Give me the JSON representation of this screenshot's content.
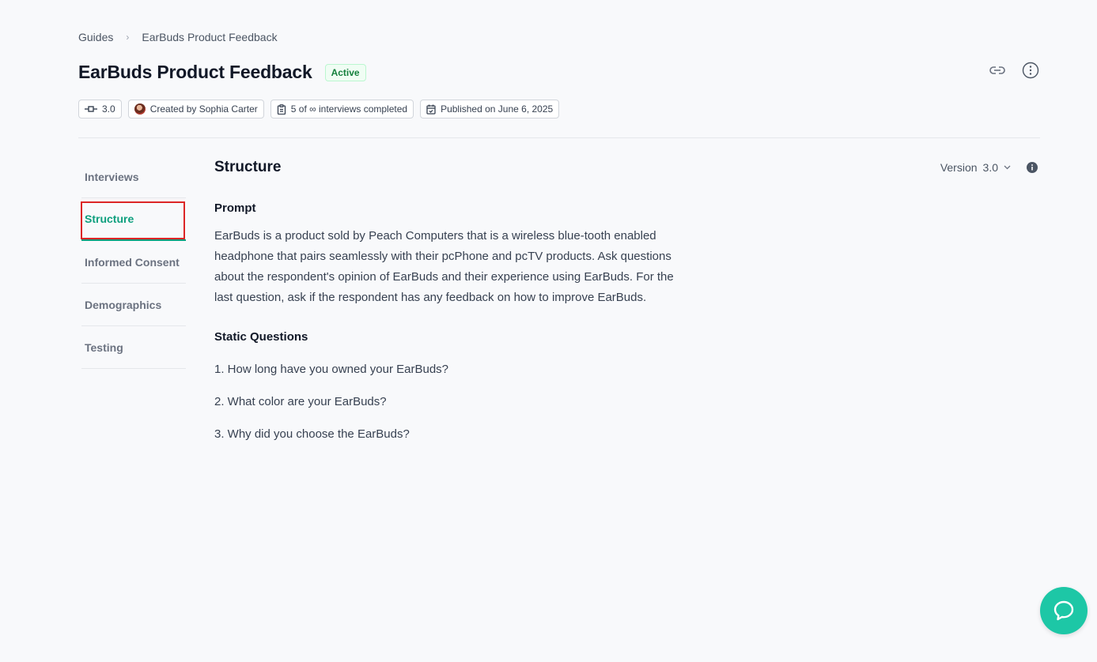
{
  "breadcrumb": {
    "root": "Guides",
    "separator": "›",
    "current": "EarBuds Product Feedback"
  },
  "header": {
    "title": "EarBuds Product Feedback",
    "status": "Active",
    "actions": [
      "link-icon",
      "more-vertical-icon"
    ]
  },
  "meta": {
    "version": "3.0",
    "created_by": "Created by Sophia Carter",
    "interviews": "5 of ∞ interviews completed",
    "published": "Published on June 6, 2025"
  },
  "nav": {
    "items": [
      {
        "label": "Interviews",
        "active": false
      },
      {
        "label": "Structure",
        "active": true
      },
      {
        "label": "Informed Consent",
        "active": false
      },
      {
        "label": "Demographics",
        "active": false
      },
      {
        "label": "Testing",
        "active": false
      }
    ]
  },
  "main": {
    "section_title": "Structure",
    "version_label": "Version",
    "version_value": "3.0",
    "prompt_heading": "Prompt",
    "prompt_text": "EarBuds is a product sold by Peach Computers that is a wireless blue-tooth enabled headphone that pairs seamlessly with their pcPhone and pcTV products. Ask questions about the respondent's opinion of EarBuds and their experience using EarBuds. For the last question, ask if the respondent has any feedback on how to improve EarBuds.",
    "static_heading": "Static Questions",
    "questions": [
      "1. How long have you owned your EarBuds?",
      "2. What color are your EarBuds?",
      "3. Why did you choose the EarBuds?"
    ]
  },
  "colors": {
    "accent": "#0e9f7e",
    "status_green": "#15803d",
    "focus_outline": "#dc2626",
    "chat_button": "#1dc7a6"
  }
}
